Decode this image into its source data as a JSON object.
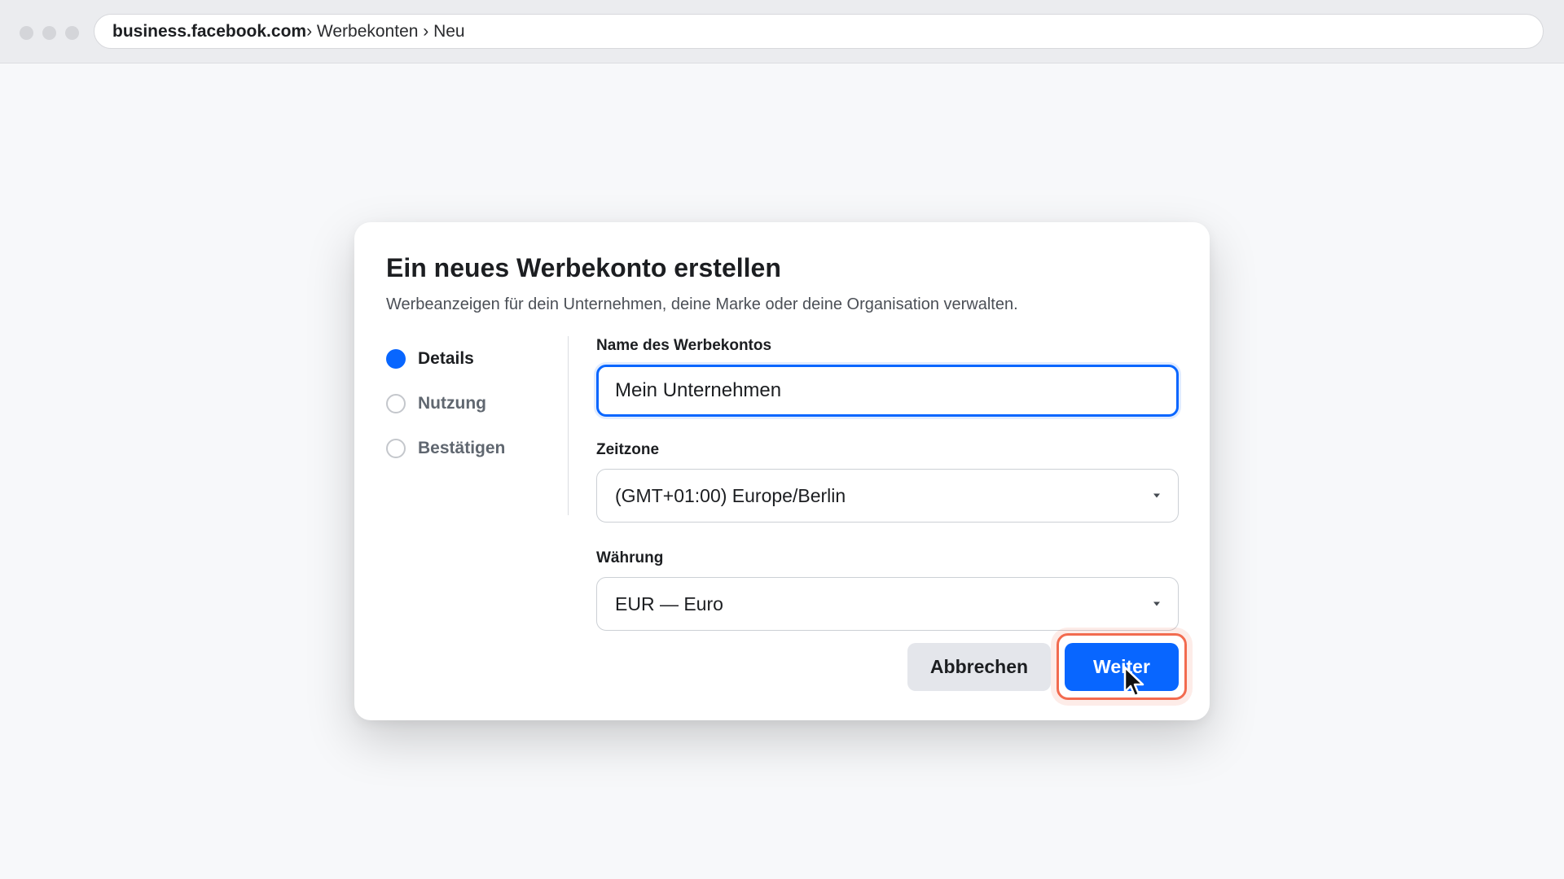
{
  "browser": {
    "url_domain": "business.facebook.com",
    "url_path": "› Werbekonten › Neu"
  },
  "dialog": {
    "title": "Ein neues Werbekonto erstellen",
    "subtitle": "Werbeanzeigen für dein Unternehmen, deine Marke oder deine Organisation verwalten.",
    "steps": [
      {
        "label": "Details",
        "active": true
      },
      {
        "label": "Nutzung",
        "active": false
      },
      {
        "label": "Bestätigen",
        "active": false
      }
    ],
    "fields": {
      "name": {
        "label": "Name des Werbekontos",
        "value": "Mein Unternehmen"
      },
      "timezone": {
        "label": "Zeitzone",
        "value": "(GMT+01:00) Europe/Berlin"
      },
      "currency": {
        "label": "Währung",
        "value": "EUR — Euro"
      }
    },
    "buttons": {
      "cancel": "Abbrechen",
      "next": "Weiter"
    }
  },
  "colors": {
    "accent": "#0866ff",
    "highlight_ring": "#f26b4f"
  }
}
